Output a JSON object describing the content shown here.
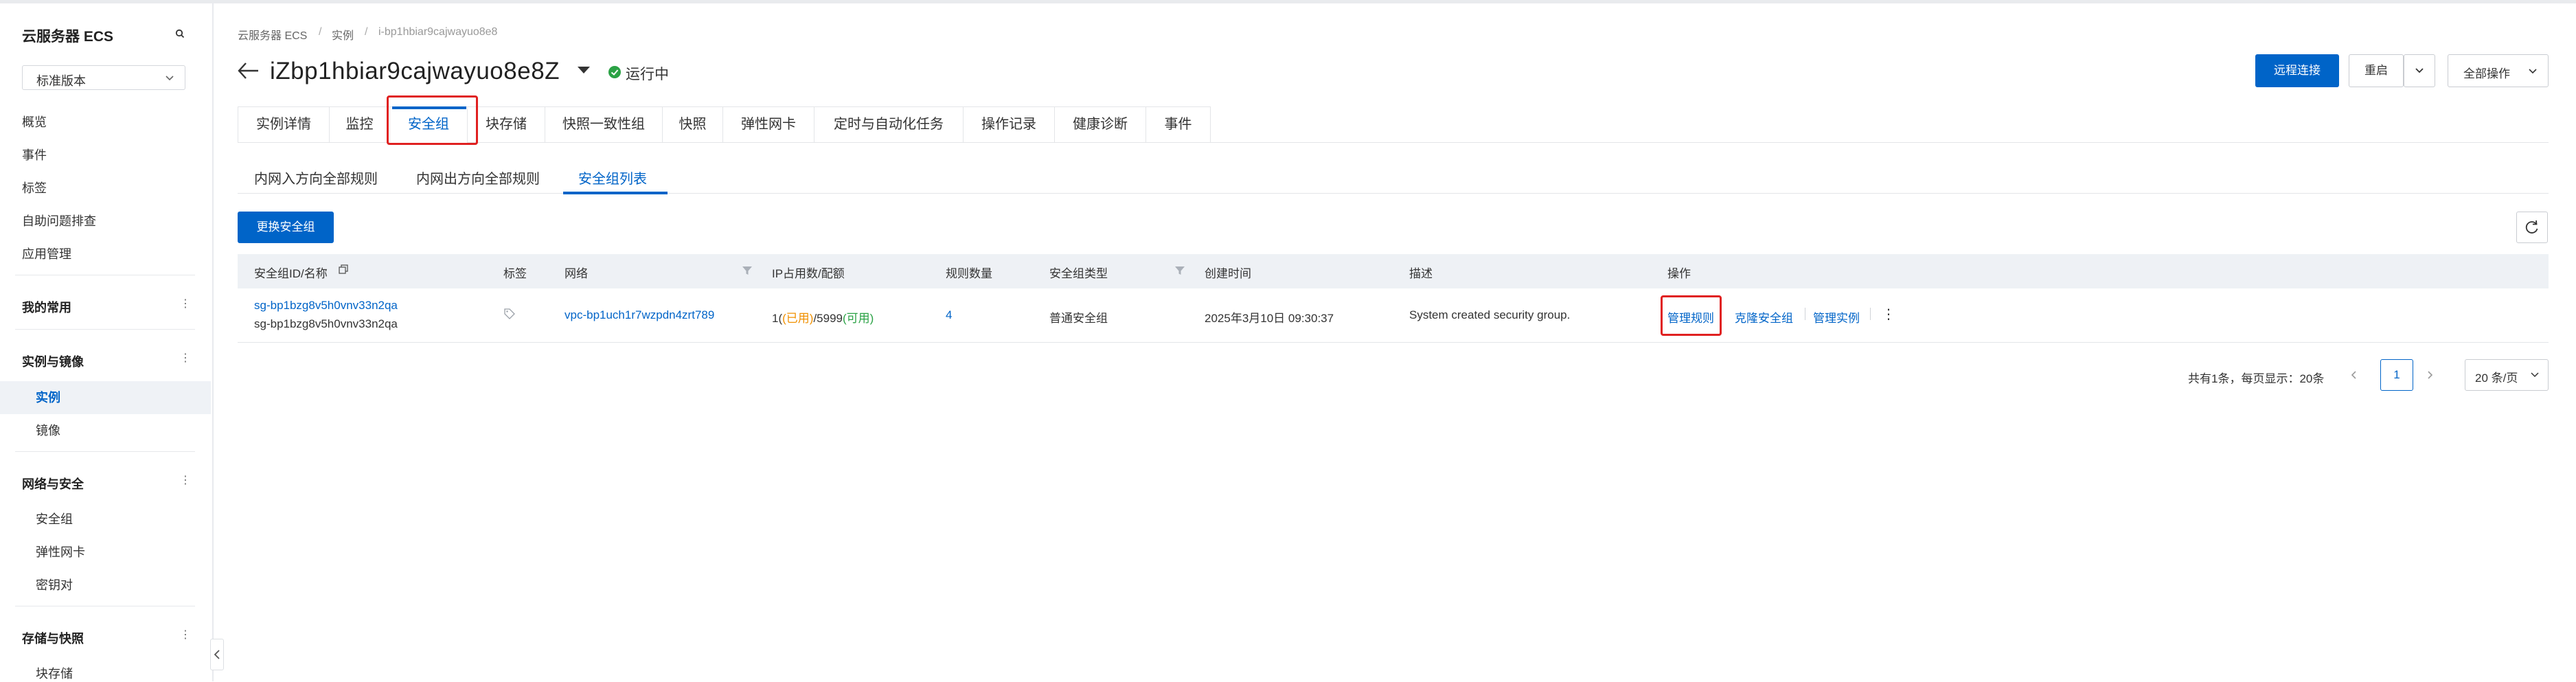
{
  "sidebar": {
    "title": "云服务器 ECS",
    "version_select": "标准版本",
    "top_links": [
      "概览",
      "事件",
      "标签",
      "自助问题排查",
      "应用管理"
    ],
    "groups": [
      {
        "label": "我的常用",
        "items": []
      },
      {
        "label": "实例与镜像",
        "items": [
          "实例",
          "镜像"
        ]
      },
      {
        "label": "网络与安全",
        "items": [
          "安全组",
          "弹性网卡",
          "密钥对"
        ]
      },
      {
        "label": "存储与快照",
        "items": [
          "块存储"
        ]
      }
    ]
  },
  "breadcrumb": [
    "云服务器 ECS",
    "实例",
    "i-bp1hbiar9cajwayuo8e8"
  ],
  "header": {
    "title": "iZbp1hbiar9cajwayuo8e8Z",
    "status": "运行中",
    "buttons": {
      "remote": "远程连接",
      "restart": "重启",
      "all_ops": "全部操作"
    }
  },
  "tabs": [
    "实例详情",
    "监控",
    "安全组",
    "块存储",
    "快照一致性组",
    "快照",
    "弹性网卡",
    "定时与自动化任务",
    "操作记录",
    "健康诊断",
    "事件"
  ],
  "active_tab": "安全组",
  "subtabs": [
    "内网入方向全部规则",
    "内网出方向全部规则",
    "安全组列表"
  ],
  "active_subtab": "安全组列表",
  "toolbar": {
    "change_sg": "更换安全组"
  },
  "table": {
    "columns": [
      "安全组ID/名称",
      "标签",
      "网络",
      "IP占用数/配额",
      "规则数量",
      "安全组类型",
      "创建时间",
      "描述",
      "操作"
    ],
    "rows": [
      {
        "sg_id": "sg-bp1bzg8v5h0vnv33n2qa",
        "sg_name": "sg-bp1bzg8v5h0vnv33n2qa",
        "vpc": "vpc-bp1uch1r7wzpdn4zrt789",
        "ip_used": "1",
        "ip_used_label": "(已用)",
        "ip_quota": "/5999",
        "ip_quota_label": "(可用)",
        "ip_prefix": "1(",
        "rules": "4",
        "type": "普通安全组",
        "created": "2025年3月10日 09:30:37",
        "description": "System created security group.",
        "ops": [
          "管理规则",
          "克隆安全组",
          "管理实例"
        ]
      }
    ]
  },
  "pagination": {
    "summary": "共有1条，每页显示：20条",
    "page": "1",
    "page_size": "20 条/页"
  },
  "colors": {
    "primary": "#0064c8",
    "highlight_box": "#e02020",
    "running": "#2ba245",
    "used": "#f09000"
  }
}
